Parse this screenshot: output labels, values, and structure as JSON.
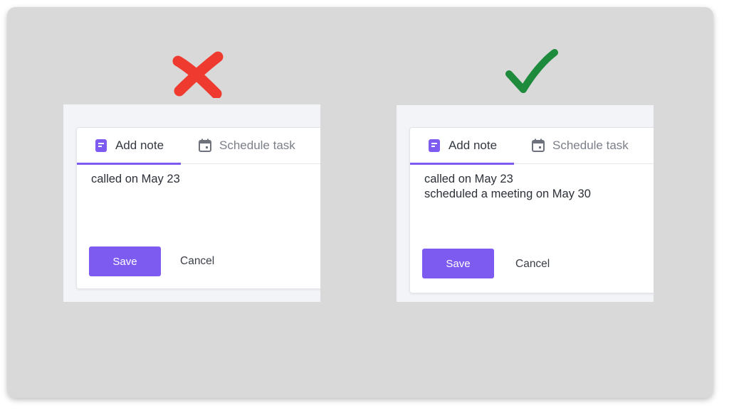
{
  "colors": {
    "accent": "#7e5bf0",
    "wrong_mark": "#ef3b2f",
    "right_mark": "#1e8a3c",
    "background": "#d9d9d9"
  },
  "marks": {
    "wrong": "cross-icon",
    "right": "checkmark-icon"
  },
  "wrong_example": {
    "tabs": [
      {
        "label": "Add note",
        "icon": "note-icon",
        "active": true
      },
      {
        "label": "Schedule task",
        "icon": "calendar-icon",
        "active": false
      }
    ],
    "note_lines": [
      "called on May 23"
    ],
    "save_label": "Save",
    "cancel_label": "Cancel"
  },
  "right_example": {
    "tabs": [
      {
        "label": "Add note",
        "icon": "note-icon",
        "active": true
      },
      {
        "label": "Schedule task",
        "icon": "calendar-icon",
        "active": false
      }
    ],
    "note_lines": [
      "called on May 23",
      "scheduled a meeting on May 30"
    ],
    "save_label": "Save",
    "cancel_label": "Cancel"
  }
}
